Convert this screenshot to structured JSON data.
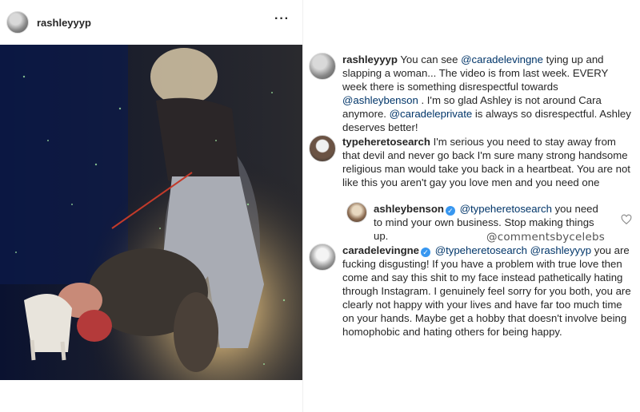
{
  "post": {
    "username": "rashleyyyp",
    "more_label": "···",
    "avatar_icon": "profile-photo"
  },
  "comments": [
    {
      "username": "rashleyyyp",
      "parts": [
        {
          "t": " You can see "
        },
        {
          "m": "@caradelevingne"
        },
        {
          "t": " tying up and slapping a woman... The video is from last week. EVERY week there is something disrespectful towards "
        },
        {
          "m": "@ashleybenson"
        },
        {
          "t": " . I'm so glad Ashley is not around Cara anymore. "
        },
        {
          "m": "@caradeleprivate"
        },
        {
          "t": " is always so disrespectful. Ashley deserves better!"
        }
      ]
    },
    {
      "username": "typeheretosearch",
      "parts": [
        {
          "t": " I'm serious you need to stay away from that devil and never go back I'm sure many strong handsome religious man would take you back in a heartbeat. You are not like this you aren't gay you love men and you need one"
        }
      ]
    },
    {
      "username": "ashleybenson",
      "verified": true,
      "parts": [
        {
          "m": " @typeheretosearch"
        },
        {
          "t": " you need to mind your own business. Stop making things up."
        }
      ]
    },
    {
      "username": "caradelevingne",
      "verified": true,
      "parts": [
        {
          "m": " @typeheretosearch"
        },
        {
          "t": " "
        },
        {
          "m": "@rashleyyyp"
        },
        {
          "t": " you are fucking disgusting! If you have a problem with true love then come and say this shit to my face instead pathetically hating through Instagram. I genuinely feel sorry for you both, you are clearly not happy with your lives and have far too much time on your hands. Maybe get a hobby that doesn't involve being homophobic and hating others for being happy."
        }
      ]
    }
  ],
  "watermark": "@commentsbycelebs",
  "colors": {
    "mention": "#003569",
    "verified": "#3897f0",
    "text": "#262626"
  }
}
